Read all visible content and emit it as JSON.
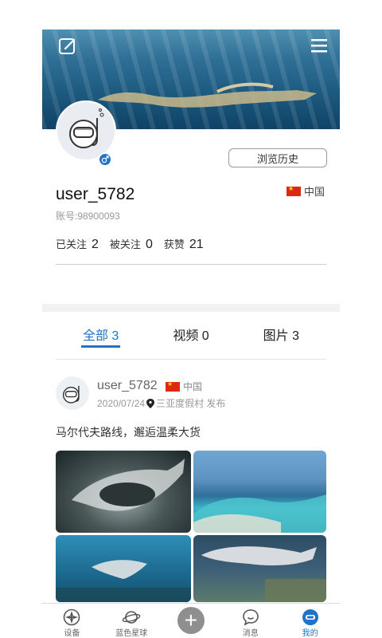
{
  "profile": {
    "username": "user_5782",
    "account_id": "账号:98900093",
    "country": "中国",
    "history_button": "浏览历史",
    "stats": [
      {
        "label": "已关注",
        "value": "2"
      },
      {
        "label": "被关注",
        "value": "0"
      },
      {
        "label": "获赞",
        "value": "21"
      }
    ]
  },
  "tabs": [
    {
      "label": "全部 3",
      "active": true
    },
    {
      "label": "视频 0",
      "active": false
    },
    {
      "label": "图片 3",
      "active": false
    }
  ],
  "post": {
    "username": "user_5782",
    "country": "中国",
    "date": "2020/07/24",
    "location": "三亚度假村 发布",
    "text": "马尔代夫路线，邂逅温柔大货"
  },
  "bottom_nav": [
    {
      "label": "设备",
      "icon": "device-icon"
    },
    {
      "label": "蓝色星球",
      "icon": "planet-icon"
    },
    {
      "label": "",
      "icon": "plus-icon"
    },
    {
      "label": "消息",
      "icon": "message-icon"
    },
    {
      "label": "我的",
      "icon": "diver-mask-icon",
      "active": true
    }
  ],
  "colors": {
    "accent": "#1f73c8",
    "flag_red": "#de2910"
  }
}
